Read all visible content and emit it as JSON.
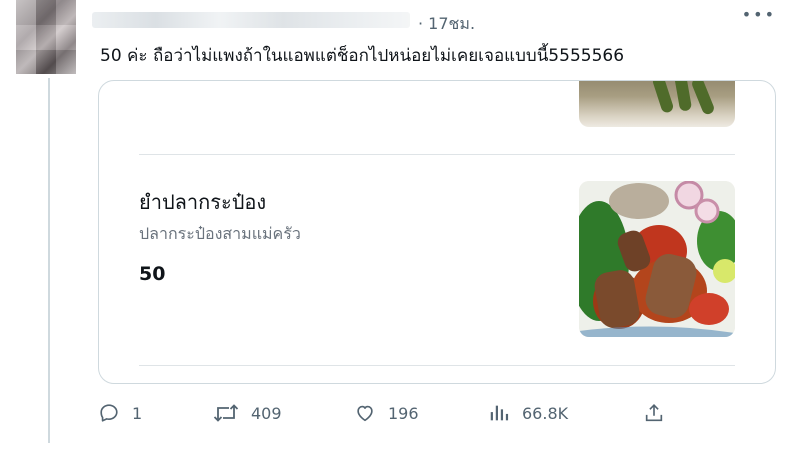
{
  "post": {
    "author_display": "",
    "time": "· 17ชม.",
    "text": "50 ค่ะ ถือว่าไม่แพงถ้าในแอพแต่ช็อกไปหน่อยไม่เคยเจอแบบนี้5555566"
  },
  "card": {
    "item": {
      "title": "ยำปลากระป๋อง",
      "description": "ปลากระป๋องสามแม่ครัว",
      "price": "50"
    }
  },
  "actions": {
    "replies": "1",
    "reposts": "409",
    "likes": "196",
    "views": "66.8K"
  },
  "icons": {
    "more": "more-icon",
    "reply": "reply-icon",
    "repost": "repost-icon",
    "like": "heart-icon",
    "views": "views-icon",
    "share": "share-icon"
  },
  "colors": {
    "text": "#0f1419",
    "muted": "#536471",
    "border": "#cfd9de"
  }
}
